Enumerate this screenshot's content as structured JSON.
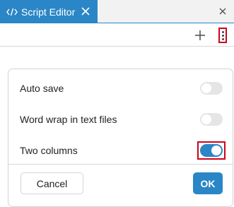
{
  "tab": {
    "title": "Script Editor",
    "icon": "code-icon",
    "close_icon": "close-icon"
  },
  "window": {
    "close_icon": "close-icon"
  },
  "toolbar": {
    "add_icon": "plus-icon",
    "menu_icon": "more-vertical-icon"
  },
  "settings": [
    {
      "label": "Auto save",
      "enabled": false
    },
    {
      "label": "Word wrap in text files",
      "enabled": false
    },
    {
      "label": "Two columns",
      "enabled": true
    }
  ],
  "buttons": {
    "cancel": "Cancel",
    "ok": "OK"
  },
  "colors": {
    "accent": "#2a86c6",
    "highlight": "#d0021b",
    "toggle_off": "#e5e5e5"
  }
}
